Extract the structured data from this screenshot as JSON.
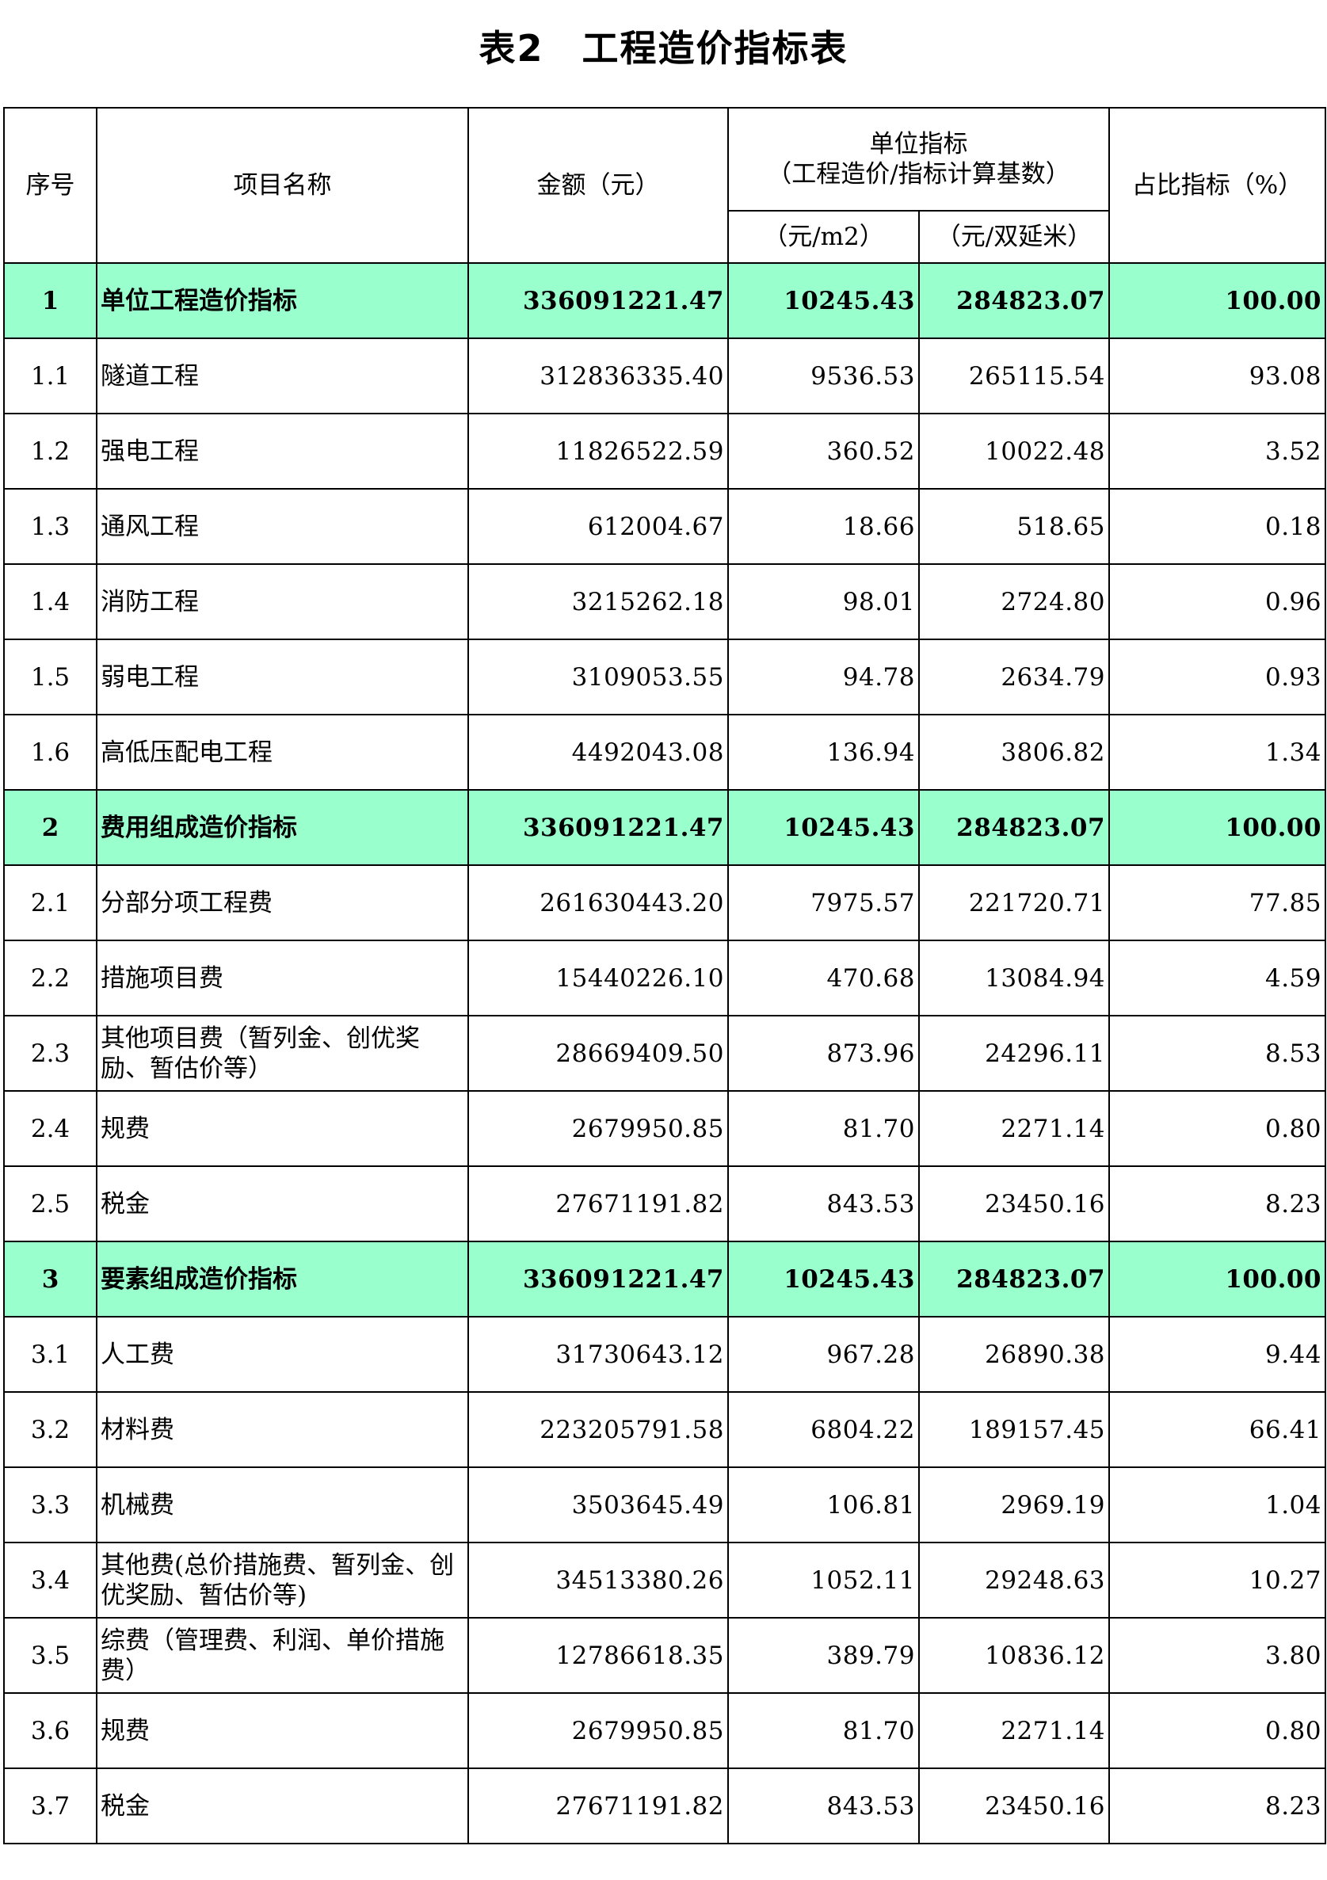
{
  "title": "表2　工程造价指标表",
  "colors": {
    "section_row_bg": "#99ffcc",
    "border": "#000000"
  },
  "headers": {
    "seq": "序号",
    "name": "项目名称",
    "amount": "金额（元）",
    "unit_index_line1": "单位指标",
    "unit_index_line2": "（工程造价/指标计算基数）",
    "per_m2": "（元/m2）",
    "per_double_m": "（元/双延米）",
    "ratio": "占比指标（%）"
  },
  "rows": [
    {
      "no": "1",
      "name": "单位工程造价指标",
      "amount": "336091221.47",
      "per_m2": "10245.43",
      "per_m": "284823.07",
      "ratio": "100.00",
      "section": true
    },
    {
      "no": "1.1",
      "name": "隧道工程",
      "amount": "312836335.40",
      "per_m2": "9536.53",
      "per_m": "265115.54",
      "ratio": "93.08",
      "section": false
    },
    {
      "no": "1.2",
      "name": "强电工程",
      "amount": "11826522.59",
      "per_m2": "360.52",
      "per_m": "10022.48",
      "ratio": "3.52",
      "section": false
    },
    {
      "no": "1.3",
      "name": "通风工程",
      "amount": "612004.67",
      "per_m2": "18.66",
      "per_m": "518.65",
      "ratio": "0.18",
      "section": false
    },
    {
      "no": "1.4",
      "name": "消防工程",
      "amount": "3215262.18",
      "per_m2": "98.01",
      "per_m": "2724.80",
      "ratio": "0.96",
      "section": false
    },
    {
      "no": "1.5",
      "name": "弱电工程",
      "amount": "3109053.55",
      "per_m2": "94.78",
      "per_m": "2634.79",
      "ratio": "0.93",
      "section": false
    },
    {
      "no": "1.6",
      "name": "高低压配电工程",
      "amount": "4492043.08",
      "per_m2": "136.94",
      "per_m": "3806.82",
      "ratio": "1.34",
      "section": false
    },
    {
      "no": "2",
      "name": "费用组成造价指标",
      "amount": "336091221.47",
      "per_m2": "10245.43",
      "per_m": "284823.07",
      "ratio": "100.00",
      "section": true
    },
    {
      "no": "2.1",
      "name": "分部分项工程费",
      "amount": "261630443.20",
      "per_m2": "7975.57",
      "per_m": "221720.71",
      "ratio": "77.85",
      "section": false
    },
    {
      "no": "2.2",
      "name": "措施项目费",
      "amount": "15440226.10",
      "per_m2": "470.68",
      "per_m": "13084.94",
      "ratio": "4.59",
      "section": false
    },
    {
      "no": "2.3",
      "name": "其他项目费（暂列金、创优奖励、暂估价等）",
      "amount": "28669409.50",
      "per_m2": "873.96",
      "per_m": "24296.11",
      "ratio": "8.53",
      "section": false
    },
    {
      "no": "2.4",
      "name": "规费",
      "amount": "2679950.85",
      "per_m2": "81.70",
      "per_m": "2271.14",
      "ratio": "0.80",
      "section": false
    },
    {
      "no": "2.5",
      "name": "税金",
      "amount": "27671191.82",
      "per_m2": "843.53",
      "per_m": "23450.16",
      "ratio": "8.23",
      "section": false
    },
    {
      "no": "3",
      "name": "要素组成造价指标",
      "amount": "336091221.47",
      "per_m2": "10245.43",
      "per_m": "284823.07",
      "ratio": "100.00",
      "section": true
    },
    {
      "no": "3.1",
      "name": "人工费",
      "amount": "31730643.12",
      "per_m2": "967.28",
      "per_m": "26890.38",
      "ratio": "9.44",
      "section": false
    },
    {
      "no": "3.2",
      "name": "材料费",
      "amount": "223205791.58",
      "per_m2": "6804.22",
      "per_m": "189157.45",
      "ratio": "66.41",
      "section": false
    },
    {
      "no": "3.3",
      "name": "机械费",
      "amount": "3503645.49",
      "per_m2": "106.81",
      "per_m": "2969.19",
      "ratio": "1.04",
      "section": false
    },
    {
      "no": "3.4",
      "name": "其他费(总价措施费、暂列金、创优奖励、暂估价等)",
      "amount": "34513380.26",
      "per_m2": "1052.11",
      "per_m": "29248.63",
      "ratio": "10.27",
      "section": false
    },
    {
      "no": "3.5",
      "name": "综费（管理费、利润、单价措施费）",
      "amount": "12786618.35",
      "per_m2": "389.79",
      "per_m": "10836.12",
      "ratio": "3.80",
      "section": false
    },
    {
      "no": "3.6",
      "name": "规费",
      "amount": "2679950.85",
      "per_m2": "81.70",
      "per_m": "2271.14",
      "ratio": "0.80",
      "section": false
    },
    {
      "no": "3.7",
      "name": "税金",
      "amount": "27671191.82",
      "per_m2": "843.53",
      "per_m": "23450.16",
      "ratio": "8.23",
      "section": false
    }
  ]
}
